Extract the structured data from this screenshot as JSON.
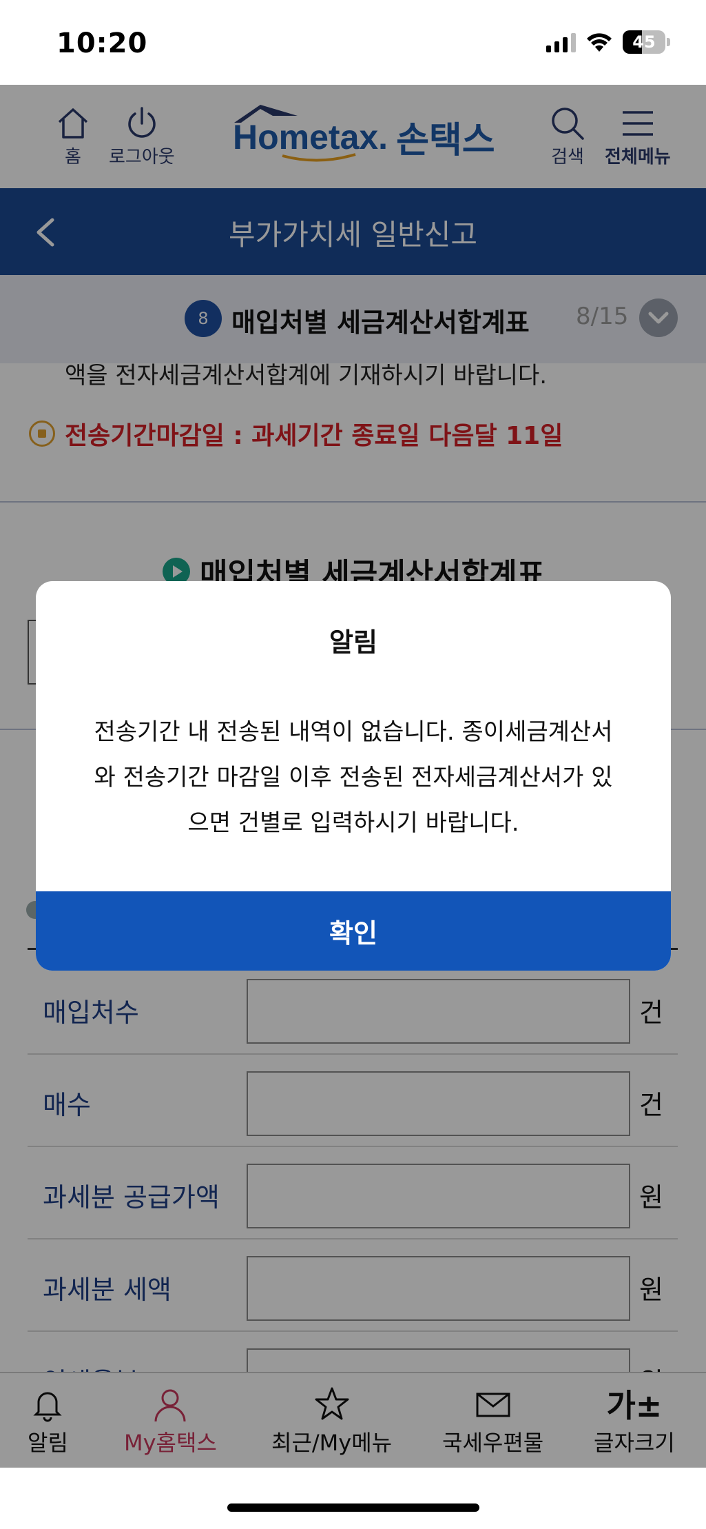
{
  "status_bar": {
    "time": "10:20",
    "battery": "45"
  },
  "header": {
    "home_label": "홈",
    "logout_label": "로그아웃",
    "logo_text_en": "Hometax.",
    "logo_text_ko": "손택스",
    "search_label": "검색",
    "menu_label": "전체메뉴"
  },
  "title_bar": {
    "title": "부가가치세 일반신고"
  },
  "step": {
    "number": "8",
    "title": "매입처별 세금계산서합계표",
    "count": "8/15"
  },
  "content": {
    "cut_text": "액을 전자세금계산서합계에 기재하시기 바랍니다.",
    "notice": "전송기간마감일 : 과세기간 종료일 다음달 11일",
    "section_title": "매입처별 세금계산서합계표",
    "rows": [
      {
        "label": "매입처수",
        "unit": "건",
        "value": ""
      },
      {
        "label": "매수",
        "unit": "건",
        "value": ""
      },
      {
        "label": "과세분 공급가액",
        "unit": "원",
        "value": ""
      },
      {
        "label": "과세분 세액",
        "unit": "원",
        "value": ""
      },
      {
        "label": "영세율분",
        "unit": "원",
        "value": ""
      }
    ]
  },
  "modal": {
    "title": "알림",
    "line1": "전송기간 내 전송된 내역이 없습니다. 종이세금계산서",
    "line2": "와 전송기간 마감일 이후 전송된 전자세금계산서가 있",
    "line3": "으면 건별로 입력하시기 바랍니다.",
    "ok_label": "확인"
  },
  "bottom_nav": {
    "items": [
      {
        "label": "알림",
        "icon": "bell-icon"
      },
      {
        "label": "My홈택스",
        "icon": "person-icon"
      },
      {
        "label": "최근/My메뉴",
        "icon": "star-icon"
      },
      {
        "label": "국세우편물",
        "icon": "mail-icon"
      },
      {
        "label": "글자크기",
        "icon": "font-size-icon",
        "glyph": "가±"
      }
    ]
  },
  "colors": {
    "primary": "#1c4a93",
    "button": "#1255b8",
    "alert": "#d42027",
    "active_nav": "#c8385d"
  }
}
